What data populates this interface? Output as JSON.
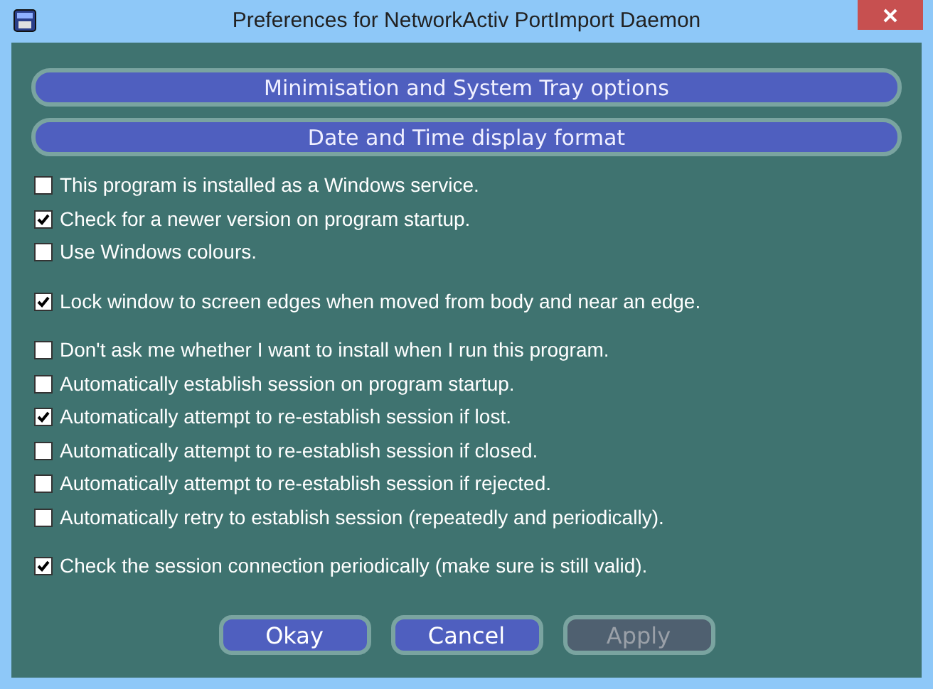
{
  "window": {
    "title": "Preferences for NetworkActiv PortImport Daemon"
  },
  "section_buttons": [
    "Minimisation and System Tray options",
    "Date and Time display format"
  ],
  "option_groups": [
    {
      "options": [
        {
          "label": "This program is installed as a Windows service.",
          "checked": false
        },
        {
          "label": "Check for a newer version on program startup.",
          "checked": true
        },
        {
          "label": "Use Windows colours.",
          "checked": false
        }
      ]
    },
    {
      "options": [
        {
          "label": "Lock window to screen edges when moved from body and near an edge.",
          "checked": true
        }
      ]
    },
    {
      "options": [
        {
          "label": "Don't ask me whether I want to install when I run this program.",
          "checked": false
        },
        {
          "label": "Automatically establish session on program startup.",
          "checked": false
        },
        {
          "label": "Automatically attempt to re-establish session if lost.",
          "checked": true
        },
        {
          "label": "Automatically attempt to re-establish session if closed.",
          "checked": false
        },
        {
          "label": "Automatically attempt to re-establish session if rejected.",
          "checked": false
        },
        {
          "label": "Automatically retry to establish session (repeatedly and periodically).",
          "checked": false
        }
      ]
    },
    {
      "options": [
        {
          "label": "Check the session connection periodically (make sure is still valid).",
          "checked": true
        }
      ]
    }
  ],
  "buttons": [
    {
      "label": "Okay",
      "disabled": false
    },
    {
      "label": "Cancel",
      "disabled": false
    },
    {
      "label": "Apply",
      "disabled": true
    }
  ]
}
